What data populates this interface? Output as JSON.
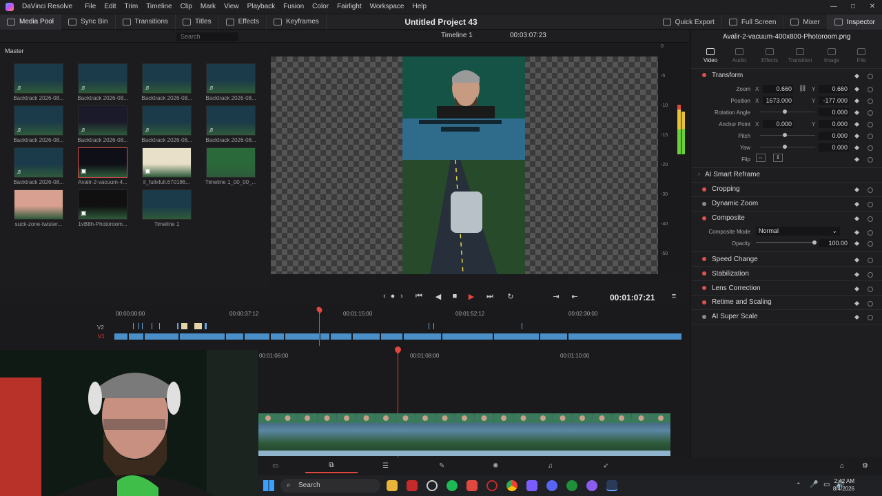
{
  "menubar": {
    "app_name": "DaVinci Resolve",
    "items": [
      "File",
      "Edit",
      "Trim",
      "Timeline",
      "Clip",
      "Mark",
      "View",
      "Playback",
      "Fusion",
      "Color",
      "Fairlight",
      "Workspace",
      "Help"
    ]
  },
  "toolbar": {
    "media_pool": "Media Pool",
    "sync_bin": "Sync Bin",
    "transitions": "Transitions",
    "titles": "Titles",
    "effects": "Effects",
    "keyframes": "Keyframes",
    "project_title": "Untitled Project 43",
    "quick_export": "Quick Export",
    "full_screen": "Full Screen",
    "mixer": "Mixer",
    "inspector": "Inspector"
  },
  "subbar": {
    "search_placeholder": "Search",
    "timeline_name": "Timeline 1",
    "viewer_timecode": "00:03:07:23"
  },
  "media_pool": {
    "bin_label": "Master",
    "clips": [
      {
        "name": "Backtrack 2026-08...",
        "badge": "♬"
      },
      {
        "name": "Backtrack 2026-08...",
        "badge": "♬"
      },
      {
        "name": "Backtrack 2026-08...",
        "badge": "♬"
      },
      {
        "name": "Backtrack 2026-08...",
        "badge": "♬"
      },
      {
        "name": "Backtrack 2026-08...",
        "badge": "♬"
      },
      {
        "name": "Backtrack 2026-08...",
        "badge": "♬"
      },
      {
        "name": "Backtrack 2026-08...",
        "badge": "♬"
      },
      {
        "name": "Backtrack 2026-08...",
        "badge": "♬"
      },
      {
        "name": "Backtrack 2026-08...",
        "badge": "♬"
      },
      {
        "name": "Avalir-2-vacuum-4...",
        "badge": "▣"
      },
      {
        "name": "il_fullxfull.670186...",
        "badge": "▣"
      },
      {
        "name": "Timeline 1_00_00_...",
        "badge": ""
      },
      {
        "name": "suck-zone-twister...",
        "badge": ""
      },
      {
        "name": "1vB8h-Photoroom...",
        "badge": "▣"
      },
      {
        "name": "Timeline 1",
        "badge": ""
      }
    ]
  },
  "transport": {
    "timecode": "00:01:07:21"
  },
  "meter": {
    "scale": [
      "0",
      "-5",
      "-10",
      "-15",
      "-20",
      "-30",
      "-40",
      "-50"
    ]
  },
  "inspector": {
    "clip_name": "Avalir-2-vacuum-400x800-Photoroom.png",
    "tabs": [
      "Video",
      "Audio",
      "Effects",
      "Transition",
      "Image",
      "File"
    ],
    "transform": {
      "title": "Transform",
      "zoom_label": "Zoom",
      "zoom_x": "0.660",
      "zoom_y": "0.660",
      "position_label": "Position",
      "position_x": "1673.000",
      "position_y": "-177.000",
      "rotation_label": "Rotation Angle",
      "rotation": "0.000",
      "anchor_label": "Anchor Point",
      "anchor_x": "0.000",
      "anchor_y": "0.000",
      "pitch_label": "Pitch",
      "pitch": "0.000",
      "yaw_label": "Yaw",
      "yaw": "0.000",
      "flip_label": "Flip",
      "x_axis": "X",
      "y_axis": "Y"
    },
    "ai_smart_reframe": "AI Smart Reframe",
    "cropping": "Cropping",
    "dynamic_zoom": "Dynamic Zoom",
    "composite": {
      "title": "Composite",
      "mode_label": "Composite Mode",
      "mode_value": "Normal",
      "opacity_label": "Opacity",
      "opacity_value": "100.00"
    },
    "speed_change": "Speed Change",
    "stabilization": "Stabilization",
    "lens_correction": "Lens Correction",
    "retime_scaling": "Retime and Scaling",
    "ai_super_scale": "AI Super Scale"
  },
  "timeline": {
    "track_v2": "V2",
    "track_v1": "V1",
    "upper_ticks": [
      "00:00:00:00",
      "00:00:37:12",
      "00:01:15:00",
      "00:01:52:12",
      "00:02:30:00"
    ],
    "lower_ticks": [
      "00:01:06:00",
      "00:01:08:00",
      "00:01:10:00"
    ]
  },
  "taskbar": {
    "search": "Search",
    "time": "2:42 AM",
    "date": "8/4/2026"
  }
}
